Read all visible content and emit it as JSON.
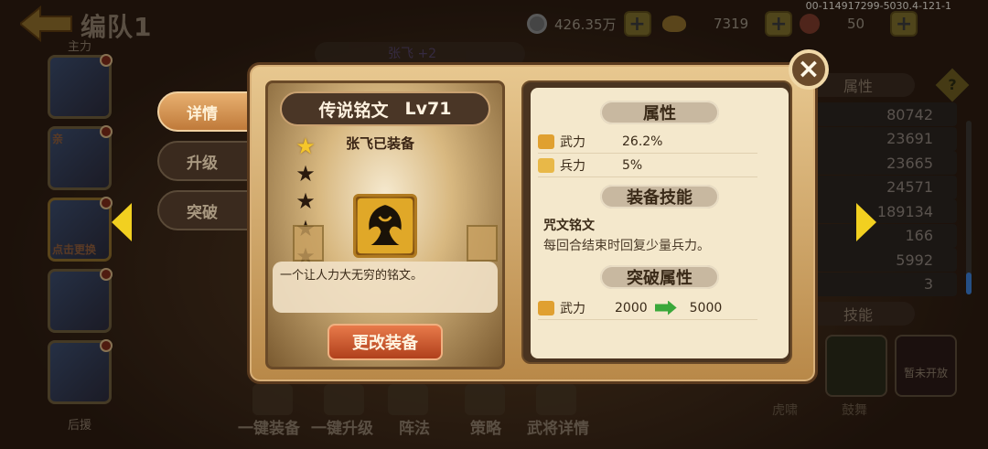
{
  "header": {
    "title": "编队1",
    "main_label": "主力",
    "reserve_label": "后援",
    "version": "00-114917299-5030.4-121-1"
  },
  "resources": {
    "silver": "426.35万",
    "gold": "7319",
    "stamina": "50",
    "plus": "+"
  },
  "roster": {
    "tags": [
      "",
      "亲",
      "点击更换",
      "",
      ""
    ]
  },
  "side_tabs": [
    {
      "label": "详情",
      "active": true
    },
    {
      "label": "升级",
      "active": false
    },
    {
      "label": "突破",
      "active": false
    }
  ],
  "bottom_bar": [
    "一键装备",
    "一键升级",
    "阵法",
    "策略",
    "武将详情"
  ],
  "right_panel": {
    "attr_title": "属性",
    "help": "?",
    "values": [
      "80742",
      "23691",
      "23665",
      "24571",
      "189134",
      "166",
      "5992",
      "3"
    ],
    "skill_title": "技能",
    "skill_slots": [
      "虎啸",
      "鼓舞"
    ],
    "locked_label": "暂未开放"
  },
  "modal": {
    "close": "×",
    "behind_tab": "张飞 +2",
    "item": {
      "name": "传说铭文",
      "level": "Lv71",
      "equipped_by": "张飞已装备",
      "stars_total": 5,
      "stars_lit": 1,
      "description": "一个让人力大无穷的铭文。",
      "change_button": "更改装备"
    },
    "attributes": {
      "title": "属性",
      "rows": [
        {
          "name": "武力",
          "value": "26.2%"
        },
        {
          "name": "兵力",
          "value": "5%"
        }
      ]
    },
    "equip_skill": {
      "title": "装备技能",
      "name": "咒文铭文",
      "description": "每回合结束时回复少量兵力。"
    },
    "breakthrough": {
      "title": "突破属性",
      "rows": [
        {
          "name": "武力",
          "from": "2000",
          "to": "5000"
        }
      ]
    }
  },
  "colors": {
    "accent_gold": "#f5c62a",
    "button_red": "#c8502a",
    "arrow_green": "#3aa83a",
    "scroll_blue": "#3a7acc"
  }
}
